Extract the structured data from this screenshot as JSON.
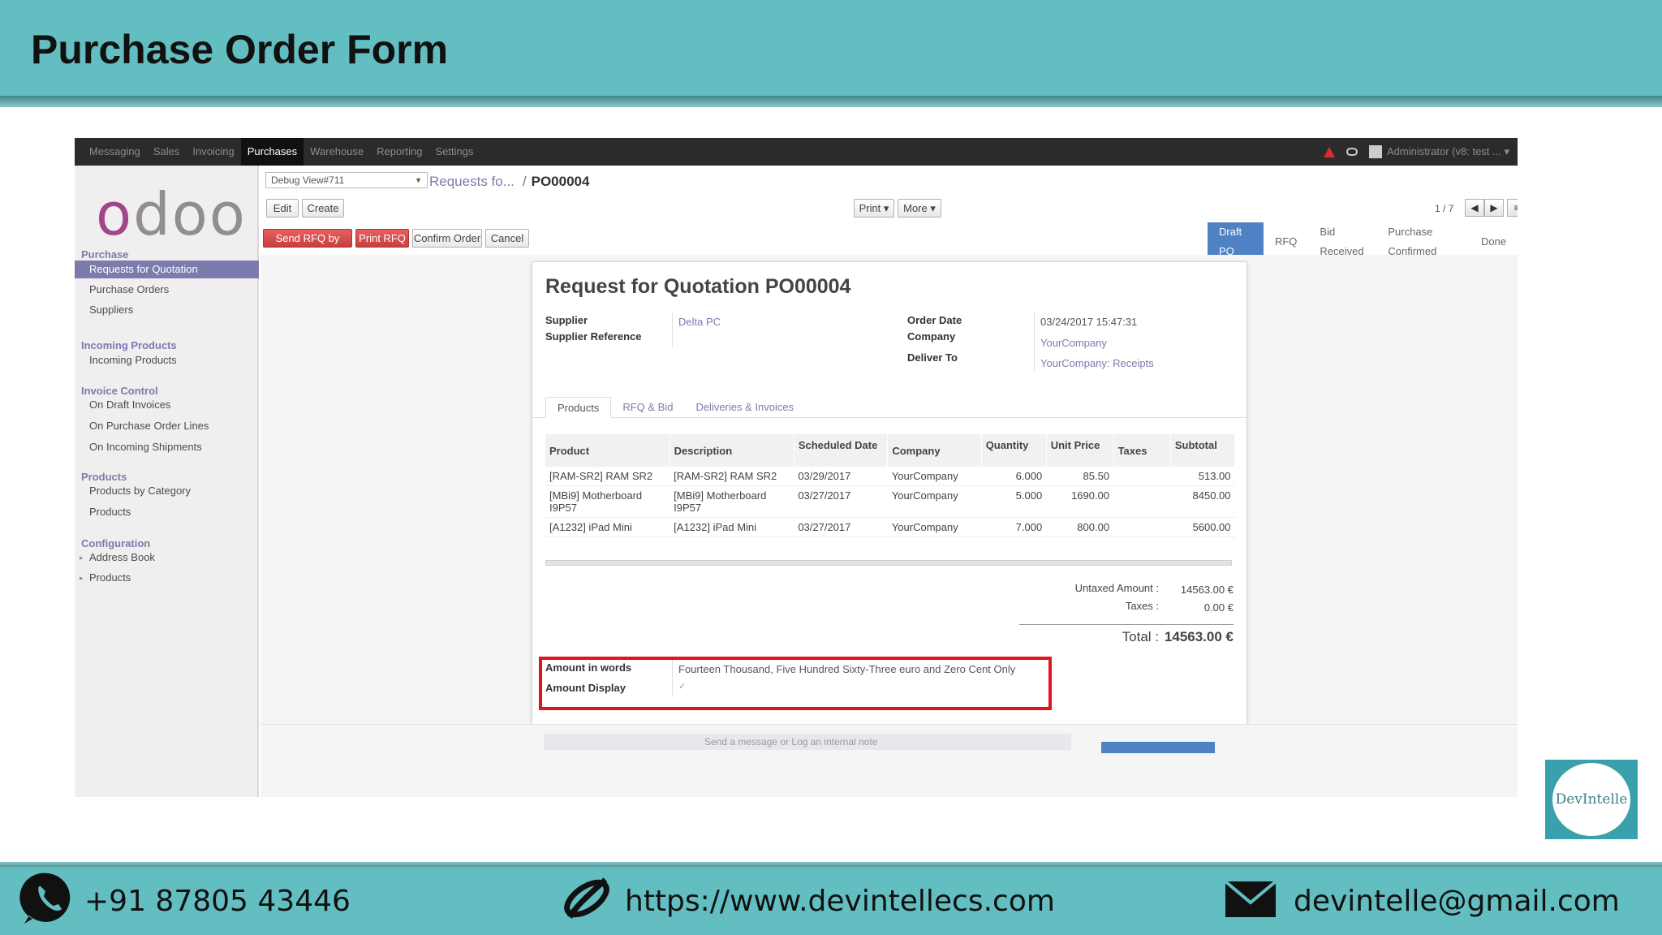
{
  "slide": {
    "title": "Purchase Order Form",
    "phone": "+91 87805 43446",
    "website": "https://www.devintellecs.com",
    "email": "devintelle@gmail.com",
    "logo_text": "DevIntelle",
    "header_color": "#63bec2"
  },
  "topbar": {
    "menu": [
      "Messaging",
      "Sales",
      "Invoicing",
      "Purchases",
      "Warehouse",
      "Reporting",
      "Settings"
    ],
    "active_menu": "Purchases",
    "user": "Administrator (v8: test ..."
  },
  "sidebar": {
    "logo": "odoo",
    "sections": [
      {
        "title": "Purchase",
        "items": [
          "Requests for Quotation",
          "Purchase Orders",
          "Suppliers"
        ]
      },
      {
        "title": "Incoming Products",
        "items": [
          "Incoming Products"
        ]
      },
      {
        "title": "Invoice Control",
        "items": [
          "On Draft Invoices",
          "On Purchase Order Lines",
          "On Incoming Shipments"
        ]
      },
      {
        "title": "Products",
        "items": [
          "Products by Category",
          "Products"
        ]
      },
      {
        "title": "Configuration",
        "items": [
          "Address Book",
          "Products"
        ]
      }
    ],
    "active_item": "Requests for Quotation"
  },
  "toolbar": {
    "debug_select": "Debug View#711",
    "breadcrumb_parent": "Requests fo...",
    "breadcrumb_current": "PO00004",
    "edit": "Edit",
    "create": "Create",
    "print": "Print ▾",
    "more": "More ▾",
    "pager": "1 / 7"
  },
  "actions": {
    "send_rfq": "Send RFQ by Email",
    "print_rfq": "Print RFQ",
    "confirm": "Confirm Order",
    "cancel": "Cancel"
  },
  "status_steps": [
    "Draft PO",
    "RFQ",
    "Bid Received",
    "Purchase Confirmed",
    "Done"
  ],
  "status_current": "Draft PO",
  "form": {
    "title": "Request for Quotation PO00004",
    "supplier_label": "Supplier",
    "supplier": "Delta PC",
    "supplier_ref_label": "Supplier Reference",
    "order_date_label": "Order Date",
    "order_date": "03/24/2017 15:47:31",
    "company_label": "Company",
    "company": "YourCompany",
    "deliver_to_label": "Deliver To",
    "deliver_to": "YourCompany: Receipts"
  },
  "tabs": [
    "Products",
    "RFQ & Bid",
    "Deliveries & Invoices"
  ],
  "lines": {
    "headers": [
      "Product",
      "Description",
      "Scheduled Date",
      "Company",
      "Quantity",
      "Unit Price",
      "Taxes",
      "Subtotal"
    ],
    "rows": [
      {
        "product": "[RAM-SR2] RAM SR2",
        "description": "[RAM-SR2] RAM SR2",
        "date": "03/29/2017",
        "company": "YourCompany",
        "qty": "6.000",
        "price": "85.50",
        "taxes": "",
        "subtotal": "513.00"
      },
      {
        "product": "[MBi9] Motherboard I9P57",
        "description": "[MBi9] Motherboard I9P57",
        "date": "03/27/2017",
        "company": "YourCompany",
        "qty": "5.000",
        "price": "1690.00",
        "taxes": "",
        "subtotal": "8450.00"
      },
      {
        "product": "[A1232] iPad Mini",
        "description": "[A1232] iPad Mini",
        "date": "03/27/2017",
        "company": "YourCompany",
        "qty": "7.000",
        "price": "800.00",
        "taxes": "",
        "subtotal": "5600.00"
      }
    ]
  },
  "totals": {
    "untaxed_label": "Untaxed Amount :",
    "untaxed": "14563.00 €",
    "taxes_label": "Taxes :",
    "taxes": "0.00 €",
    "total_label": "Total :",
    "total": "14563.00 €"
  },
  "amount": {
    "words_label": "Amount in words",
    "words": "Fourteen Thousand, Five Hundred Sixty-Three euro and Zero Cent Only",
    "display_label": "Amount Display",
    "display_check": "✓"
  },
  "chatter": {
    "text": "Send a message   or   Log an internal note"
  }
}
